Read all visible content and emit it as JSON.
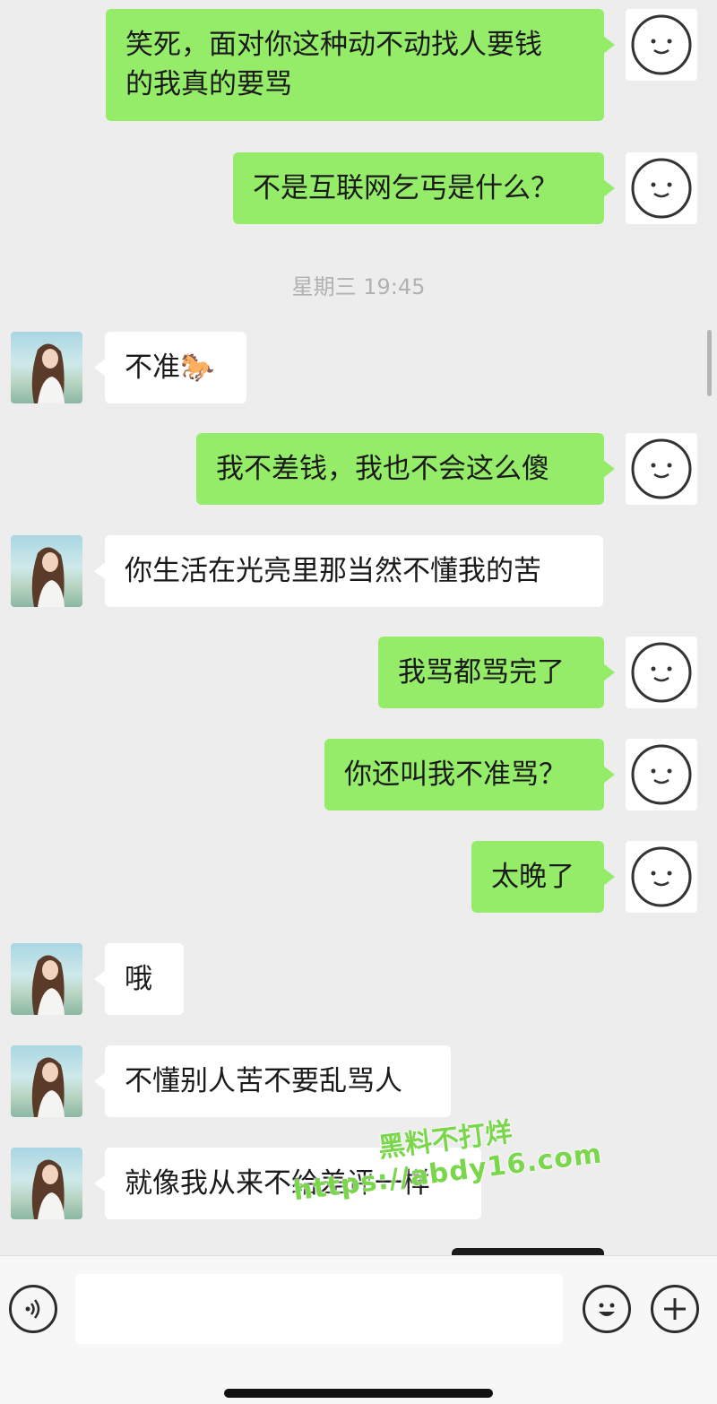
{
  "chat": {
    "timestamp": "星期三 19:45",
    "messages": [
      {
        "sender": "me",
        "text": "笑死，面对你这种动不动找人要钱\n的我真的要骂"
      },
      {
        "sender": "me",
        "text": "不是互联网乞丐是什么？"
      },
      {
        "sender": "her",
        "text": "不准🐎"
      },
      {
        "sender": "me",
        "text": "我不差钱，我也不会这么傻"
      },
      {
        "sender": "her",
        "text": "你生活在光亮里那当然不懂我的苦"
      },
      {
        "sender": "me",
        "text": "我骂都骂完了"
      },
      {
        "sender": "me",
        "text": "你还叫我不准骂？"
      },
      {
        "sender": "me",
        "text": "太晚了"
      },
      {
        "sender": "her",
        "text": "哦"
      },
      {
        "sender": "her",
        "text": "不懂别人苦不要乱骂人"
      },
      {
        "sender": "her",
        "text": "就像我从来不给差评一样"
      }
    ]
  },
  "watermark": {
    "line1": "黑料不打烊",
    "line2": "https://abdy16.com"
  },
  "input_bar": {
    "placeholder": "",
    "icons": [
      "voice-icon",
      "emoji-icon",
      "plus-icon"
    ]
  },
  "colors": {
    "my_bubble": "#95ec69",
    "her_bubble": "#ffffff",
    "background": "#ededed"
  }
}
